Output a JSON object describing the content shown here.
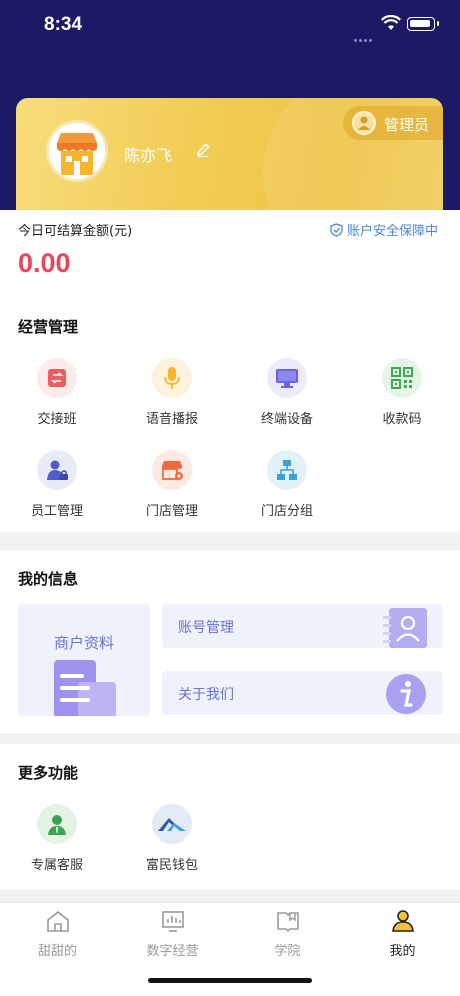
{
  "status": {
    "time": "8:34"
  },
  "profile": {
    "name": "陈亦飞",
    "role": "管理员"
  },
  "balance": {
    "label": "今日可结算金额(元)",
    "amount": "0.00",
    "security": "账户安全保障中"
  },
  "business": {
    "title": "经营管理",
    "items": [
      {
        "label": "交接班"
      },
      {
        "label": "语音播报"
      },
      {
        "label": "终端设备"
      },
      {
        "label": "收款码"
      },
      {
        "label": "员工管理"
      },
      {
        "label": "门店管理"
      },
      {
        "label": "门店分组"
      }
    ]
  },
  "my_info": {
    "title": "我的信息",
    "merchant": "商户资料",
    "account": "账号管理",
    "about": "关于我们"
  },
  "more": {
    "title": "更多功能",
    "items": [
      {
        "label": "专属客服"
      },
      {
        "label": "富民钱包"
      }
    ]
  },
  "tabs": [
    {
      "label": "甜甜的",
      "icon": "home-icon"
    },
    {
      "label": "数字经营",
      "icon": "chart-icon"
    },
    {
      "label": "学院",
      "icon": "book-icon"
    },
    {
      "label": "我的",
      "icon": "user-icon",
      "active": true
    }
  ],
  "colors": {
    "header_bg": "#1c1a64",
    "card_gold": "#f2cd55",
    "amount_red": "#e4485a",
    "accent_purple": "#6a72d0",
    "link_blue": "#4a86d6"
  }
}
